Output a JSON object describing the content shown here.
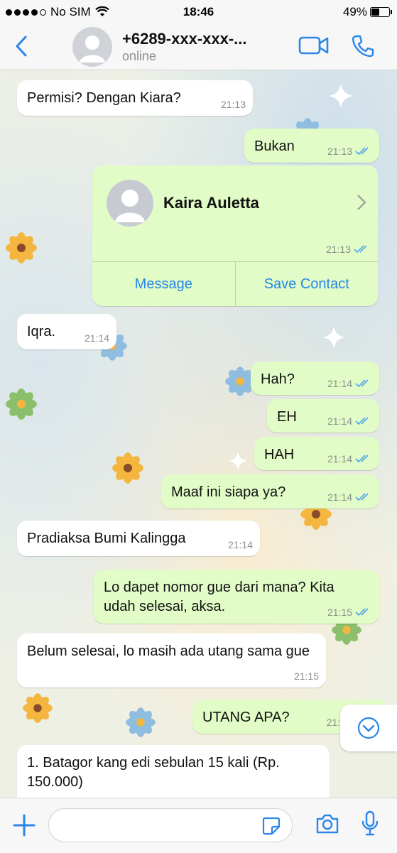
{
  "status_bar": {
    "carrier": "No SIM",
    "time": "18:46",
    "battery": "49%",
    "battery_level": 0.49
  },
  "header": {
    "title": "+6289-xxx-xxx-...",
    "status": "online",
    "icons": [
      "back-chevron-icon",
      "video-call-icon",
      "phone-icon"
    ]
  },
  "messages": [
    {
      "dir": "in",
      "text": "Permisi? Dengan Kiara?",
      "time": "21:13"
    },
    {
      "dir": "out",
      "text": "Bukan",
      "time": "21:13"
    },
    {
      "dir": "in",
      "text": "Iqra.",
      "time": "21:14"
    },
    {
      "dir": "out",
      "text": "Hah?",
      "time": "21:14"
    },
    {
      "dir": "out",
      "text": "EH",
      "time": "21:14"
    },
    {
      "dir": "out",
      "text": "HAH",
      "time": "21:14"
    },
    {
      "dir": "out",
      "text": "Maaf ini siapa ya?",
      "time": "21:14"
    },
    {
      "dir": "in",
      "text": "Pradiaksa Bumi Kalingga",
      "time": "21:14"
    },
    {
      "dir": "out",
      "text": "Lo dapet nomor gue dari mana? Kita udah selesai, aksa.",
      "time": "21:15"
    },
    {
      "dir": "in",
      "text": "Belum selesai, lo masih ada utang sama gue",
      "time": "21:15"
    },
    {
      "dir": "out",
      "text": "UTANG APA?",
      "time": "21:1"
    },
    {
      "dir": "in",
      "text": "1. Batagor kang edi sebulan 15 kali (Rp. 150.000)"
    }
  ],
  "contact_card": {
    "name": "Kaira Auletta",
    "time": "21:13",
    "message_label": "Message",
    "save_label": "Save Contact"
  },
  "input": {
    "placeholder": ""
  },
  "colors": {
    "accent": "#2a86e8",
    "outgoing_bubble": "#e1fcc7",
    "incoming_bubble": "#ffffff",
    "read_ticks": "#4fa3e8"
  }
}
